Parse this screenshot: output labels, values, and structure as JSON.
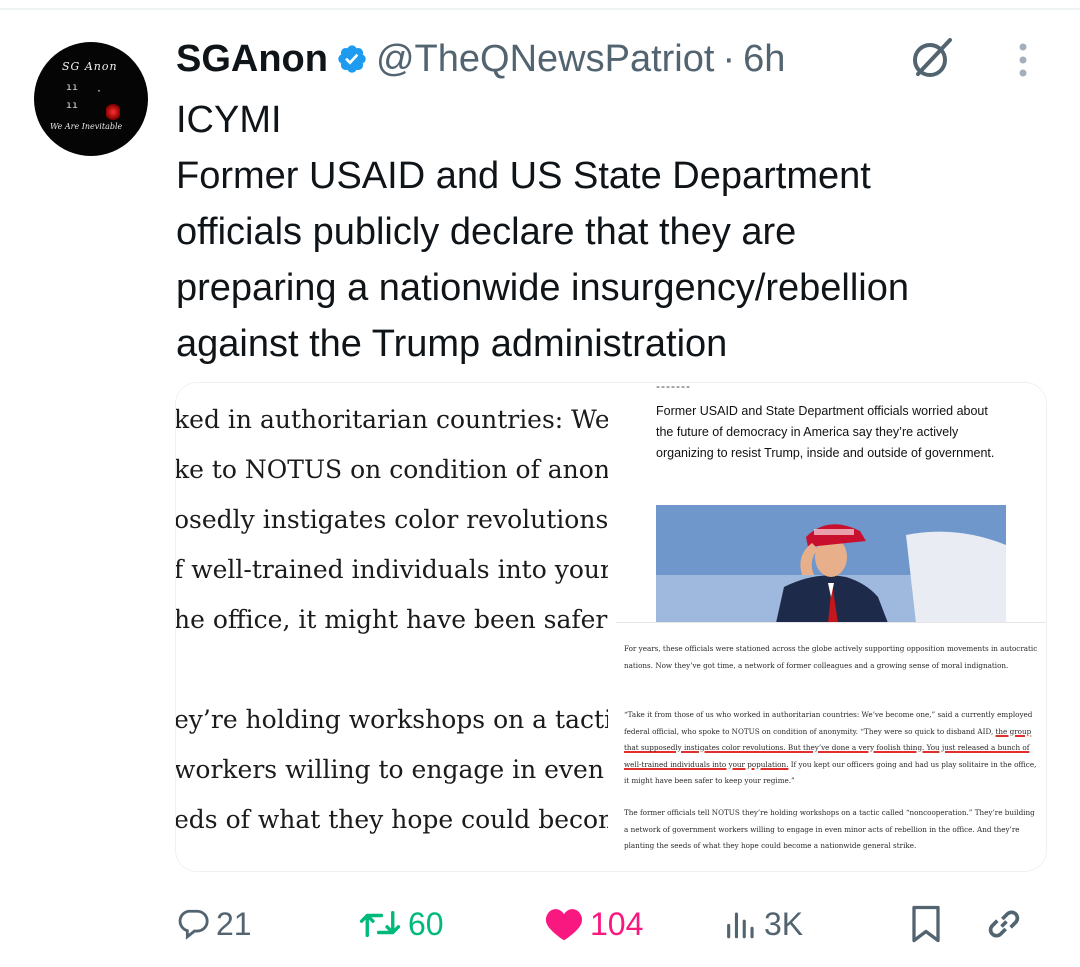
{
  "author": {
    "display_name": "SGAnon",
    "handle": "@TheQNewsPatriot",
    "separator": "·",
    "time_ago": "6h",
    "avatar_text_top": "SG Anon",
    "avatar_text_bottom": "We Are Inevitable"
  },
  "tweet": {
    "lines": [
      "ICYMI",
      "Former USAID and US State Department",
      "officials publicly declare that they are",
      "preparing a nationwide insurgency/rebellion",
      "against the Trump administration"
    ]
  },
  "media": {
    "left_crop_lines": [
      "ked in authoritarian countries: We’v",
      "ke to NOTUS on condition of anony",
      "osedly instigates color revolutions. B",
      "f well-trained individuals into your p",
      "he office, it might have been safer to",
      "ey’re holding workshops on a tactic",
      "workers willing to engage in even m",
      "eds of what they hope could become"
    ],
    "right_top_dash": "-------",
    "right_top_caption": "Former USAID and State Department officials worried about the future of democracy in America say they’re actively organizing to resist Trump, inside and outside of government.",
    "right_bottom_paragraphs": {
      "p1": "For years, these officials were stationed across the globe actively supporting opposition movements in autocratic nations. Now they’ve got time, a network of former colleagues and a growing sense of moral indignation.",
      "p2_before": "“Take it from those of us who worked in authoritarian countries: We’ve become one,” said a currently employed federal official, who spoke to NOTUS on condition of anonymity. “They were so quick to disband AID, ",
      "p2_highlight": "the group that supposedly instigates color revolutions. But they’ve done a very foolish thing. You just released a bunch of well-trained individuals into your population.",
      "p2_after": " If you kept our officers going and had us play solitaire in the office, it might have been safer to keep your regime.”",
      "p3": "The former officials tell NOTUS they’re holding workshops on a tactic called “noncooperation.” They’re building a network of government workers willing to engage in even minor acts of rebellion in the office. And they’re planting the seeds of what they hope could become a nationwide general strike."
    }
  },
  "actions": {
    "replies": "21",
    "reposts": "60",
    "likes": "104",
    "views": "3K"
  },
  "colors": {
    "verified": "#1d9bf0",
    "repost": "#00ba7c",
    "like": "#f91880",
    "muted": "#536471"
  }
}
